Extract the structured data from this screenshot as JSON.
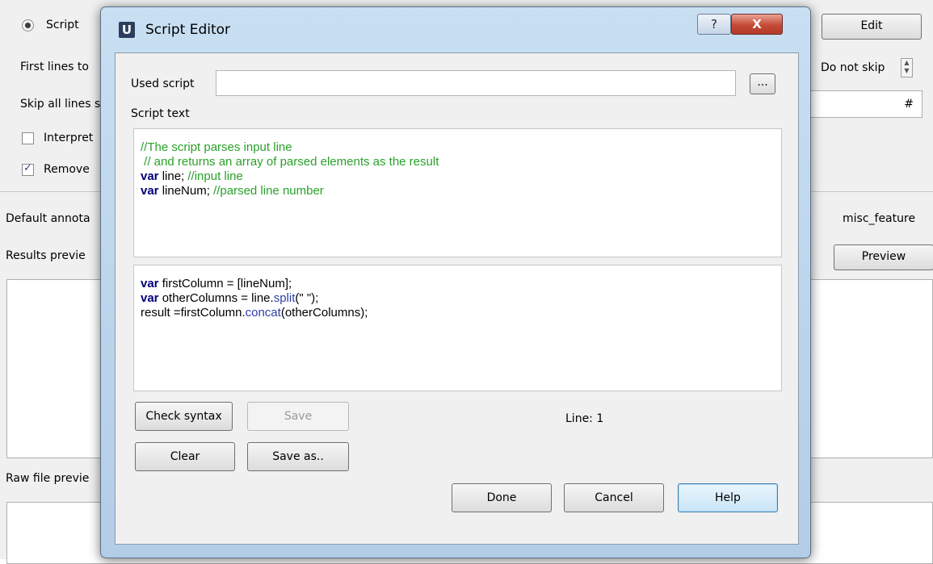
{
  "background": {
    "script_radio_label": "Script",
    "edit_button": "Edit",
    "first_lines_label": "First  lines to",
    "do_not_skip_value": "Do not skip",
    "skip_all_lines_label": "Skip all lines s",
    "skip_char_value": "#",
    "interpret_label": "Interpret",
    "remove_label": "Remove",
    "default_annotation_label": "Default annota",
    "default_annotation_value": "misc_feature",
    "results_preview_label": "Results previe",
    "preview_button": "Preview",
    "raw_file_preview_label": "Raw file previe"
  },
  "dialog": {
    "icon_letter": "U",
    "title": "Script Editor",
    "help_icon": "?",
    "close_icon": "X",
    "used_script_label": "Used script",
    "used_script_value": "",
    "browse_button": "...",
    "script_text_label": "Script text",
    "header_code": [
      [
        {
          "cls": "cm",
          "t": "//The script parses input line"
        }
      ],
      [
        {
          "cls": "cm",
          "t": " // and returns an array of parsed elements as the result"
        }
      ],
      [
        {
          "cls": "kw",
          "t": "var"
        },
        {
          "cls": "",
          "t": " line; "
        },
        {
          "cls": "cm",
          "t": "//input line"
        }
      ],
      [
        {
          "cls": "kw",
          "t": "var"
        },
        {
          "cls": "",
          "t": " lineNum; "
        },
        {
          "cls": "cm",
          "t": "//parsed line number"
        }
      ]
    ],
    "body_code": [
      [
        {
          "cls": "kw",
          "t": "var"
        },
        {
          "cls": "",
          "t": " firstColumn = [lineNum];"
        }
      ],
      [
        {
          "cls": "kw",
          "t": "var"
        },
        {
          "cls": "",
          "t": " otherColumns = line."
        },
        {
          "cls": "fn",
          "t": "split"
        },
        {
          "cls": "",
          "t": "(\" \");"
        }
      ],
      [
        {
          "cls": "",
          "t": "result =firstColumn."
        },
        {
          "cls": "fn",
          "t": "concat"
        },
        {
          "cls": "",
          "t": "(otherColumns);"
        }
      ]
    ],
    "check_syntax_button": "Check syntax",
    "save_button": "Save",
    "line_status": "Line: 1",
    "clear_button": "Clear",
    "save_as_button": "Save as..",
    "done_button": "Done",
    "cancel_button": "Cancel",
    "help_button": "Help"
  }
}
